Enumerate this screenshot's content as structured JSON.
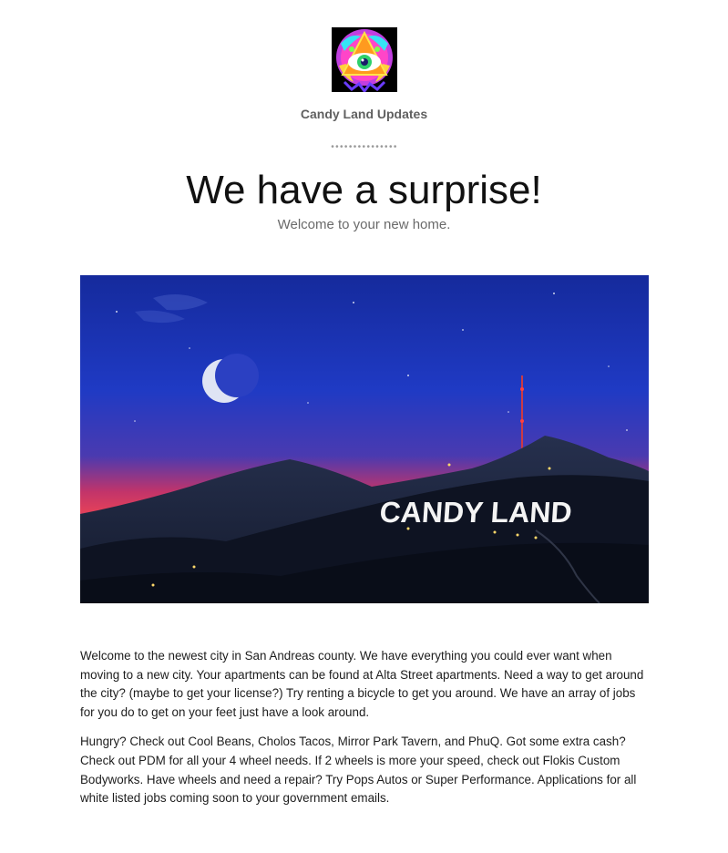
{
  "header": {
    "org_name": "Candy Land Updates",
    "divider": "•••••••••••••••"
  },
  "hero": {
    "headline": "We have a surprise!",
    "subhead": "Welcome to your new home."
  },
  "banner": {
    "sign_text": "CANDY LAND"
  },
  "body": {
    "paragraph_1": "Welcome to the newest city in San Andreas county. We have everything you could ever want when moving to a new city. Your apartments can be found at Alta Street apartments. Need a way to get around the city? (maybe to get your license?) Try renting a bicycle to get you around. We have an array of jobs for you do to get on your feet just have a look around.",
    "paragraph_2": "Hungry? Check out Cool Beans, Cholos Tacos, Mirror Park Tavern, and PhuQ. Got some extra cash? Check out PDM for all your 4 wheel needs. If 2 wheels is more your speed, check out Flokis Custom Bodyworks. Have wheels and need a repair? Try Pops Autos or Super Performance.  Applications for all white listed jobs coming soon to your government emails."
  },
  "colors": {
    "sky_top": "#1b2fb8",
    "sky_glow": "#e23a5a",
    "hills": "#121826"
  }
}
